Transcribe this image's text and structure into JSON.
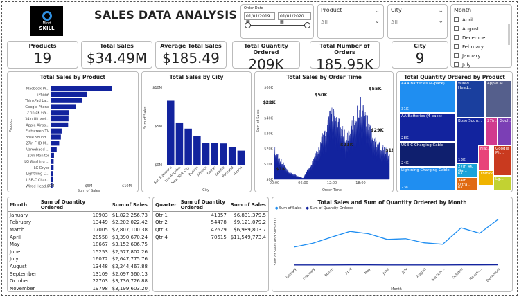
{
  "logo": {
    "line1": "Mind",
    "line2": "SKILL"
  },
  "title": "SALES DATA ANALYSIS",
  "order_date": {
    "label": "Order Date",
    "start": "01/01/2019",
    "end": "01/01/2020",
    "calendar_icon": "calendar-icon"
  },
  "product_slicer": {
    "label": "Product",
    "value": "All"
  },
  "city_slicer": {
    "label": "City",
    "value": "All"
  },
  "month_slicer": {
    "label": "Month",
    "items": [
      "April",
      "August",
      "December",
      "February",
      "January",
      "July"
    ]
  },
  "kpis": [
    {
      "label": "Products",
      "value": "19"
    },
    {
      "label": "Total Sales",
      "value": "$34.49M"
    },
    {
      "label": "Average Total Sales",
      "value": "$185.49"
    },
    {
      "label": "Total Quantity Ordered",
      "value": "209K"
    },
    {
      "label": "Total Number of Orders",
      "value": "185.95K"
    },
    {
      "label": "City",
      "value": "9"
    }
  ],
  "sales_by_product": {
    "title": "Total Sales by Product",
    "ylabel": "Product",
    "xlabel": "Sum of Sales",
    "xticks": [
      "$0M",
      "$5M",
      "$10M"
    ],
    "categories": [
      "Macbook Pr...",
      "iPhone",
      "ThinkPad La...",
      "Google Phone",
      "27in 4K Ga...",
      "34in Ultrawi...",
      "Apple Airpo...",
      "Flatscreen TV",
      "Bose Sound...",
      "27in FHD M...",
      "Vareebadd ...",
      "20in Monitor",
      "LG Washing ...",
      "LG Dryer",
      "Lightning C...",
      "USB-C Char...",
      "Wired Head..."
    ],
    "values": [
      8.0,
      4.8,
      4.1,
      3.3,
      2.4,
      2.35,
      2.3,
      1.45,
      1.35,
      1.13,
      0.8,
      0.45,
      0.4,
      0.39,
      0.35,
      0.29,
      0.25
    ]
  },
  "sales_by_city": {
    "title": "Total Sales by City",
    "ylabel": "Sum of Sales",
    "xlabel": "City",
    "yticks": [
      "$0M",
      "$5M",
      "$10M"
    ],
    "categories": [
      "San Francisco",
      "Los Angeles",
      "New York City",
      "Boston",
      "Atlanta",
      "Dallas",
      "Seattle",
      "Portland",
      "Austin"
    ],
    "values": [
      8.26,
      5.45,
      4.66,
      3.66,
      2.8,
      2.77,
      2.75,
      2.32,
      1.82
    ]
  },
  "sales_by_time": {
    "title": "Total Sales by Order Time",
    "ylabel": "Sum of Sales",
    "xlabel": "Order Time",
    "yticks": [
      "$0K",
      "$10K",
      "$20K",
      "$30K",
      "$40K",
      "$50K",
      "$60K"
    ],
    "xticks": [
      "00:00",
      "06:00",
      "12:00",
      "18:00"
    ],
    "labels": [
      "$22K",
      "$1K",
      "$50K",
      "$55K",
      "$29K",
      "$21K",
      "$18K"
    ]
  },
  "treemap": {
    "title": "Total Quantity Ordered by Product",
    "cells": [
      {
        "name": "AAA Batteries (4-pack)",
        "value": "31K",
        "color": "#1f8ef1"
      },
      {
        "name": "AA Batteries (4-pack)",
        "value": "28K",
        "color": "#12239e"
      },
      {
        "name": "USB-C Charging Cable",
        "value": "24K",
        "color": "#0f1f6e"
      },
      {
        "name": "Lightning Charging Cable",
        "value": "23K",
        "color": "#1f8ef1"
      },
      {
        "name": "Wired Head...",
        "value": "",
        "color": "#1a3f9e"
      },
      {
        "name": "Apple Ai...",
        "value": "",
        "color": "#555f8c"
      },
      {
        "name": "Bose Soun...",
        "value": "13K",
        "color": "#12239e"
      },
      {
        "name": "27in...",
        "value": "",
        "color": "#d13a8e"
      },
      {
        "name": "Gool...",
        "value": "",
        "color": "#7b3fb5"
      },
      {
        "name": "27in 4K Ga...",
        "value": "6K",
        "color": "#1aa3d9"
      },
      {
        "name": "Flat...",
        "value": "",
        "color": "#e8447a"
      },
      {
        "name": "34in Ultra...",
        "value": "6K",
        "color": "#e06a12"
      },
      {
        "name": "ThinkP...",
        "value": "",
        "color": "#f0b400"
      },
      {
        "name": "Google Ph...",
        "value": "",
        "color": "#c93a1f"
      },
      {
        "name": "Lg...",
        "value": "",
        "color": "#c2d232"
      }
    ]
  },
  "month_table": {
    "headers": [
      "Month",
      "Sum of Quantity Ordered",
      "Sum of Sales"
    ],
    "rows": [
      [
        "January",
        "10903",
        "$1,822,256.73"
      ],
      [
        "February",
        "13449",
        "$2,202,022.42"
      ],
      [
        "March",
        "17005",
        "$2,807,100.38"
      ],
      [
        "April",
        "20558",
        "$3,390,670.24"
      ],
      [
        "May",
        "18667",
        "$3,152,606.75"
      ],
      [
        "June",
        "15253",
        "$2,577,802.26"
      ],
      [
        "July",
        "16072",
        "$2,647,775.76"
      ],
      [
        "August",
        "13448",
        "$2,244,467.88"
      ],
      [
        "September",
        "13109",
        "$2,097,560.13"
      ],
      [
        "October",
        "22703",
        "$3,736,726.88"
      ],
      [
        "November",
        "19798",
        "$3,199,603.20"
      ]
    ]
  },
  "quarter_table": {
    "headers": [
      "Quarter",
      "Sum of Quantity Ordered",
      "Sum of Sales"
    ],
    "rows": [
      [
        "Qtr 1",
        "41357",
        "$6,831,379.5"
      ],
      [
        "Qtr 2",
        "54478",
        "$9,121,079.2"
      ],
      [
        "Qtr 3",
        "42629",
        "$6,989,803.7"
      ],
      [
        "Qtr 4",
        "70615",
        "$11,549,773.4"
      ]
    ]
  },
  "combo_chart": {
    "title": "Total Sales and Sum of Quantity Ordered by Month",
    "legend": [
      "Sum of Sales",
      "Sum of Quantity Ordered"
    ],
    "ylabel": "Sum of Sales and Sum of Q...",
    "xlabel": "Month",
    "colors": [
      "#1f8ef1",
      "#12239e"
    ]
  },
  "chart_data": [
    {
      "type": "bar",
      "title": "Total Sales by Product",
      "xlabel": "Sum of Sales",
      "ylabel": "Product",
      "categories": [
        "Macbook Pr...",
        "iPhone",
        "ThinkPad La...",
        "Google Phone",
        "27in 4K Ga...",
        "34in Ultrawi...",
        "Apple Airpo...",
        "Flatscreen TV",
        "Bose Sound...",
        "27in FHD M...",
        "Vareebadd ...",
        "20in Monitor",
        "LG Washing ...",
        "LG Dryer",
        "Lightning C...",
        "USB-C Char...",
        "Wired Head..."
      ],
      "values": [
        8.0,
        4.8,
        4.1,
        3.3,
        2.4,
        2.35,
        2.3,
        1.45,
        1.35,
        1.13,
        0.8,
        0.45,
        0.4,
        0.39,
        0.35,
        0.29,
        0.25
      ],
      "xlim": [
        0,
        10
      ]
    },
    {
      "type": "bar",
      "title": "Total Sales by City",
      "xlabel": "City",
      "ylabel": "Sum of Sales",
      "categories": [
        "San Francisco",
        "Los Angeles",
        "New York City",
        "Boston",
        "Atlanta",
        "Dallas",
        "Seattle",
        "Portland",
        "Austin"
      ],
      "values": [
        8.26,
        5.45,
        4.66,
        3.66,
        2.8,
        2.77,
        2.75,
        2.32,
        1.82
      ],
      "ylim": [
        0,
        10
      ]
    },
    {
      "type": "area",
      "title": "Total Sales by Order Time",
      "xlabel": "Order Time",
      "ylabel": "Sum of Sales",
      "x": [
        "00:00",
        "03:00",
        "06:00",
        "09:00",
        "12:00",
        "15:00",
        "18:00",
        "21:00",
        "24:00"
      ],
      "values": [
        22,
        5,
        1,
        20,
        50,
        30,
        55,
        29,
        18
      ],
      "ylim": [
        0,
        60
      ]
    },
    {
      "type": "line",
      "title": "Total Sales and Sum of Quantity Ordered by Month",
      "xlabel": "Month",
      "ylabel": "Sum of Sales and Sum of Q...",
      "categories": [
        "January",
        "February",
        "March",
        "April",
        "May",
        "June",
        "July",
        "August",
        "Septem...",
        "October",
        "Novem...",
        "December"
      ],
      "series": [
        {
          "name": "Sum of Sales",
          "values": [
            1.82,
            2.2,
            2.81,
            3.39,
            3.15,
            2.58,
            2.65,
            2.24,
            2.1,
            3.74,
            3.2,
            4.61
          ]
        },
        {
          "name": "Sum of Quantity Ordered",
          "values": [
            0.011,
            0.013,
            0.017,
            0.021,
            0.019,
            0.015,
            0.016,
            0.013,
            0.013,
            0.023,
            0.02,
            0.028
          ]
        }
      ]
    }
  ]
}
